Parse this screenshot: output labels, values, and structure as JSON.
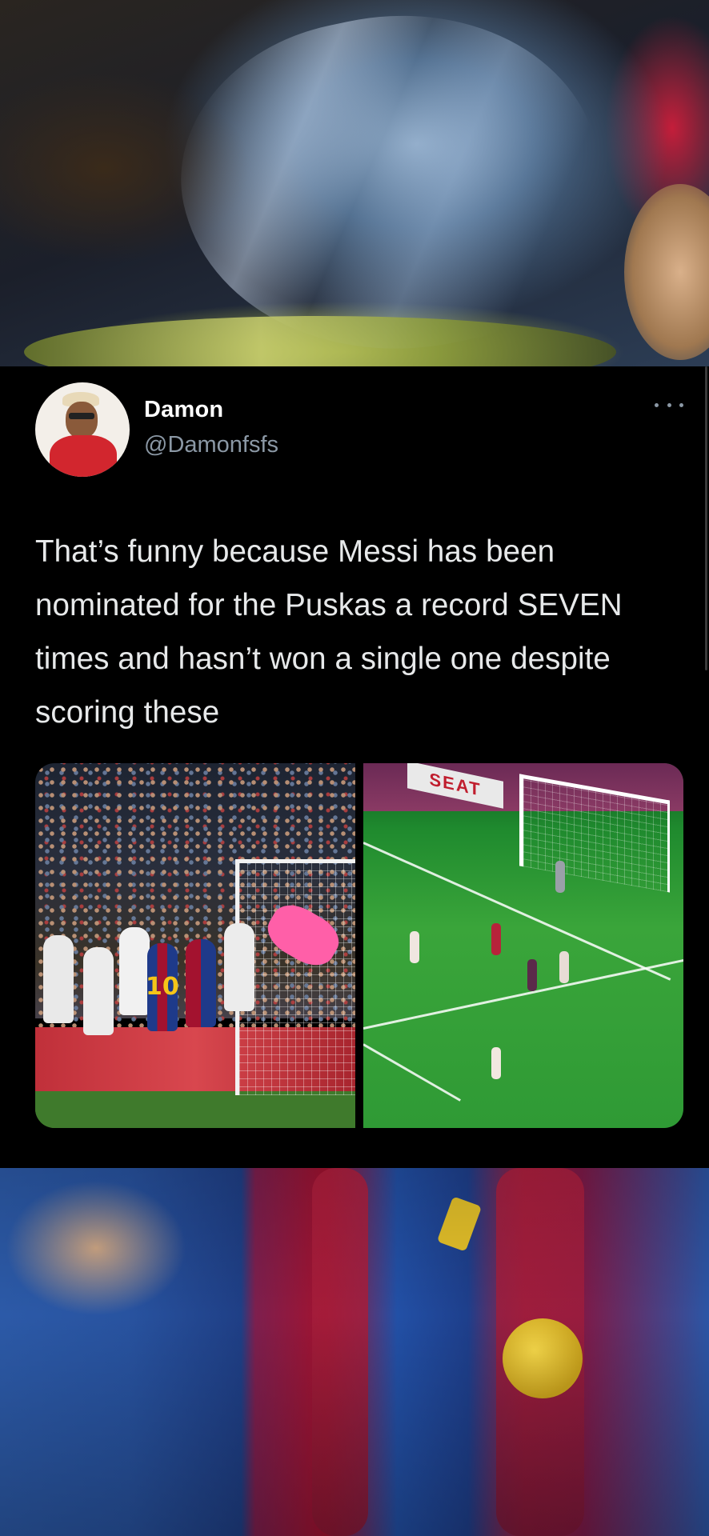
{
  "tweet": {
    "author": {
      "display_name": "Damon",
      "handle": "@Damonfsfs"
    },
    "text": "That’s funny because Messi has been nominated for the Puskas a record SEVEN times and hasn’t won a single one despite scoring these",
    "more_icon": "more-horizontal-icon",
    "media": [
      {
        "kind": "photo",
        "jersey_number": "10"
      },
      {
        "kind": "photo",
        "ad_text": "SEAT"
      }
    ]
  },
  "colors": {
    "background": "#000000",
    "text_primary": "#e7e9ea",
    "text_secondary": "#8b98a5"
  }
}
